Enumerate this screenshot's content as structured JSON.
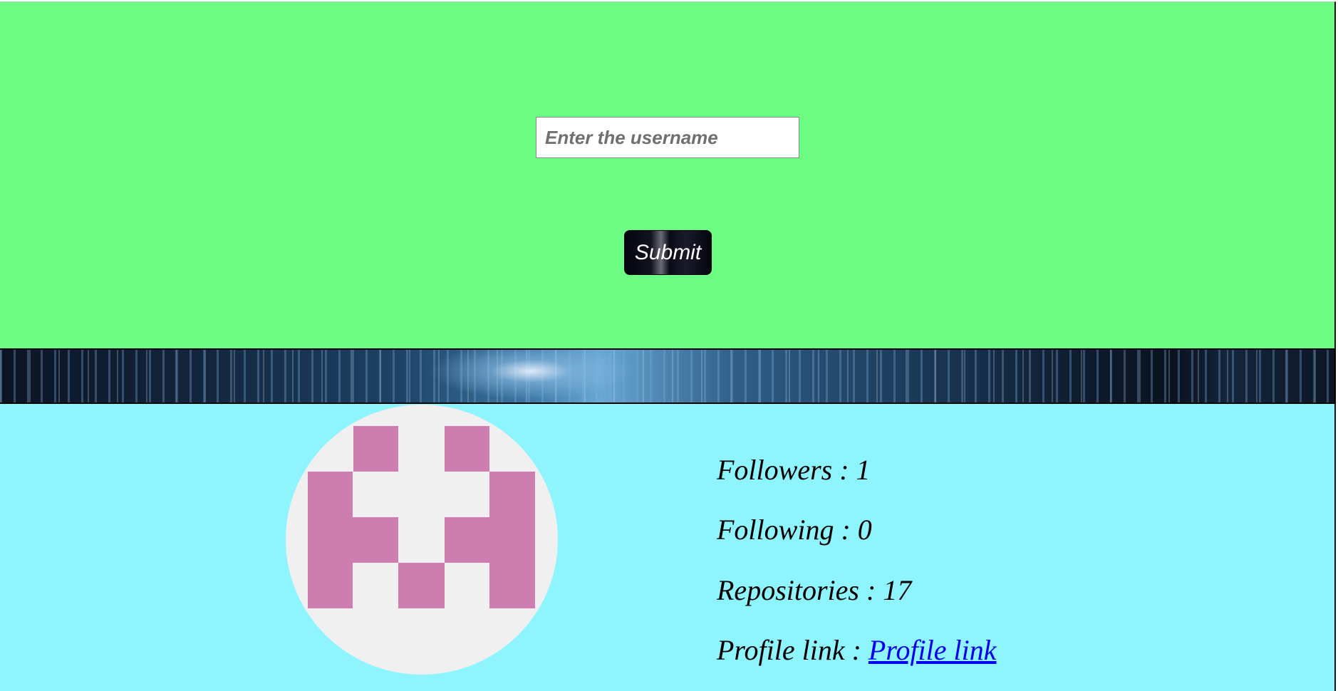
{
  "search": {
    "placeholder": "Enter the username",
    "value": "",
    "submit_label": "Submit"
  },
  "profile": {
    "followers_label": "Followers : ",
    "followers": "1",
    "following_label": "Following : ",
    "following": "0",
    "repositories_label": "Repositories : ",
    "repositories": "17",
    "profile_link_label": "Profile link : ",
    "profile_link_text": "Profile link"
  },
  "colors": {
    "search_bg": "#6dfd83",
    "profile_bg": "#8ef4fe",
    "avatar_bg": "#f0f0f0",
    "avatar_fg": "#cd7daf",
    "link": "#0000ee"
  }
}
